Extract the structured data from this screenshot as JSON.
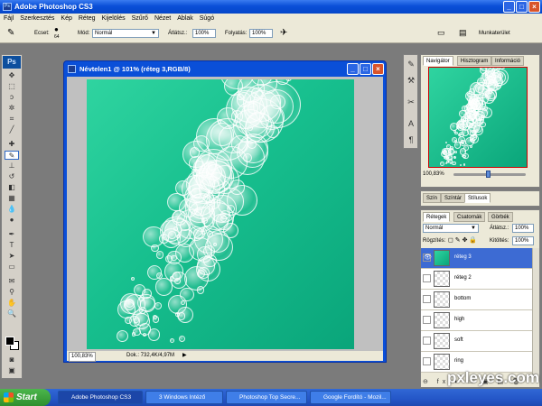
{
  "app": {
    "title": "Adobe Photoshop CS3"
  },
  "menu": [
    "Fájl",
    "Szerkesztés",
    "Kép",
    "Réteg",
    "Kijelölés",
    "Szűrő",
    "Nézet",
    "Ablak",
    "Súgó"
  ],
  "options": {
    "brush_label": "Ecset:",
    "brush_size": "64",
    "mode_label": "Mód:",
    "mode_value": "Normál",
    "opacity_label": "Átlátsz.:",
    "opacity_value": "100%",
    "flow_label": "Folyatás:",
    "flow_value": "100%",
    "workspace_label": "Munkaterület"
  },
  "toolbox": {
    "logo": "Ps"
  },
  "document": {
    "title": "Névtelen1 @ 101% (réteg 3,RGB/8)",
    "zoom": "100,83%",
    "doc_size": "Dok.: 732,4K/4,97M"
  },
  "navigator": {
    "tabs": [
      "Navigátor",
      "Hisztogram",
      "Információ"
    ],
    "zoom": "100,83%"
  },
  "color_panel": {
    "tabs": [
      "Szín",
      "Színtár",
      "Stílusok"
    ]
  },
  "layers": {
    "tabs": [
      "Rétegek",
      "Csatornák",
      "Görbék"
    ],
    "blend_mode": "Normál",
    "opacity_label": "Átlátsz.:",
    "opacity_value": "100%",
    "lock_label": "Rögzítés:",
    "fill_label": "Kitöltés:",
    "fill_value": "100%",
    "items": [
      {
        "name": "réteg 3",
        "active": true
      },
      {
        "name": "réteg 2",
        "active": false
      },
      {
        "name": "bottom",
        "active": false
      },
      {
        "name": "high",
        "active": false
      },
      {
        "name": "soft",
        "active": false
      },
      {
        "name": "ring",
        "active": false
      }
    ]
  },
  "taskbar": {
    "start": "Start",
    "tasks": [
      "Adobe Photoshop CS3",
      "3 Windows Intéző",
      "Photoshop Top Secre...",
      "Google Fordító - Mozil..."
    ]
  },
  "watermark": "pxleyes.com"
}
